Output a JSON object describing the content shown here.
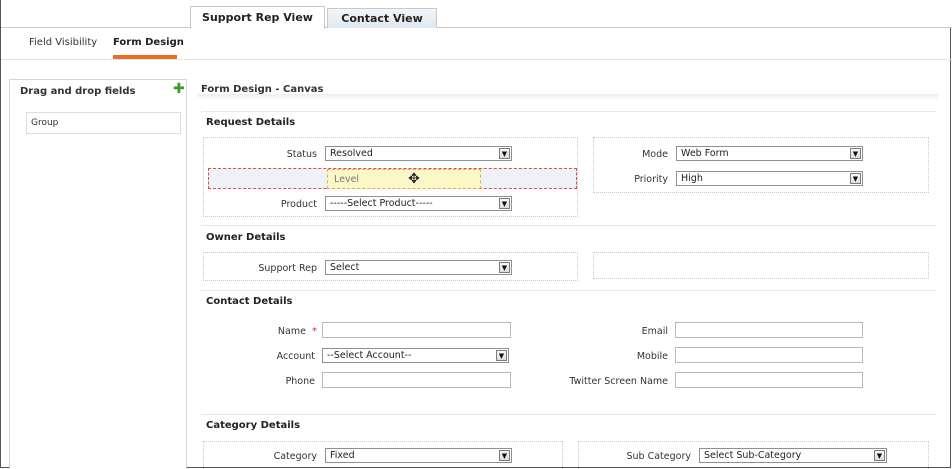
{
  "view_tabs": [
    {
      "label": "Support Rep View"
    },
    {
      "label": "Contact View"
    }
  ],
  "sub_tabs": [
    {
      "label": "Field Visibility"
    },
    {
      "label": "Form Design"
    }
  ],
  "left_panel": {
    "title": "Drag and drop fields",
    "add_icon": "plus-icon",
    "items": [
      {
        "label": "Group"
      }
    ]
  },
  "canvas": {
    "title": "Form Design - Canvas"
  },
  "request": {
    "title": "Request Details",
    "status": {
      "label": "Status",
      "value": "Resolved"
    },
    "dragging": {
      "label": "Level"
    },
    "product": {
      "label": "Product",
      "value": "-----Select Product-----"
    },
    "mode": {
      "label": "Mode",
      "value": "Web Form"
    },
    "priority": {
      "label": "Priority",
      "value": "High"
    }
  },
  "owner": {
    "title": "Owner Details",
    "support_rep": {
      "label": "Support Rep",
      "value": "Select"
    }
  },
  "contact": {
    "title": "Contact Details",
    "name": {
      "label": "Name",
      "required": "*",
      "value": ""
    },
    "account": {
      "label": "Account",
      "value": "--Select Account--"
    },
    "phone": {
      "label": "Phone",
      "value": ""
    },
    "email": {
      "label": "Email",
      "value": ""
    },
    "mobile": {
      "label": "Mobile",
      "value": ""
    },
    "twitter": {
      "label": "Twitter Screen Name",
      "value": ""
    }
  },
  "category": {
    "title": "Category Details",
    "category": {
      "label": "Category",
      "value": "Fixed"
    },
    "sub_category": {
      "label": "Sub Category",
      "value": "Select Sub-Category"
    }
  },
  "icons": {
    "dropdown_arrow": "▼",
    "move": "✥",
    "plus": "✚"
  },
  "colors": {
    "active_tab_underline": "#e76f21",
    "add_icon": "#3a9a2c",
    "required": "#e02020",
    "drag_border": "#e84848",
    "drag_chip": "#fbf8c8"
  }
}
